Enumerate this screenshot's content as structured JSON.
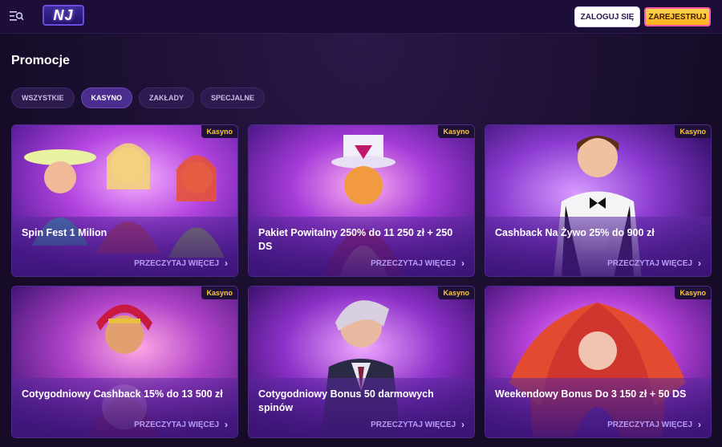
{
  "header": {
    "logo_text": "NJ",
    "login_label": "ZALOGUJ SIĘ",
    "register_label": "ZAREJESTRUJ"
  },
  "page": {
    "title": "Promocje"
  },
  "filters": [
    {
      "label": "WSZYSTKIE",
      "active": false
    },
    {
      "label": "KASYNO",
      "active": true
    },
    {
      "label": "ZAKŁADY",
      "active": false
    },
    {
      "label": "SPECJALNE",
      "active": false
    }
  ],
  "cards": [
    {
      "badge": "Kasyno",
      "title": "Spin Fest 1 Milion",
      "cta": "PRZECZYTAJ WIĘCEJ"
    },
    {
      "badge": "Kasyno",
      "title": "Pakiet Powitalny 250% do 11 250 zł + 250 DS",
      "cta": "PRZECZYTAJ WIĘCEJ"
    },
    {
      "badge": "Kasyno",
      "title": "Cashback Na Żywo 25% do 900 zł",
      "cta": "PRZECZYTAJ WIĘCEJ"
    },
    {
      "badge": "Kasyno",
      "title": "Cotygodniowy Cashback 15% do 13 500 zł",
      "cta": "PRZECZYTAJ WIĘCEJ"
    },
    {
      "badge": "Kasyno",
      "title": "Cotygodniowy Bonus 50 darmowych spinów",
      "cta": "PRZECZYTAJ WIĘCEJ"
    },
    {
      "badge": "Kasyno",
      "title": "Weekendowy Bonus Do 3 150 zł + 50 DS",
      "cta": "PRZECZYTAJ WIĘCEJ"
    }
  ],
  "colors": {
    "background": "#1a0f2e",
    "accent": "#6a48b8",
    "badge_text": "#ffc93c",
    "cta_text": "#b79bf5"
  },
  "icons": {
    "menu": "menu-search-icon",
    "chevron": "chevron-right-icon"
  }
}
